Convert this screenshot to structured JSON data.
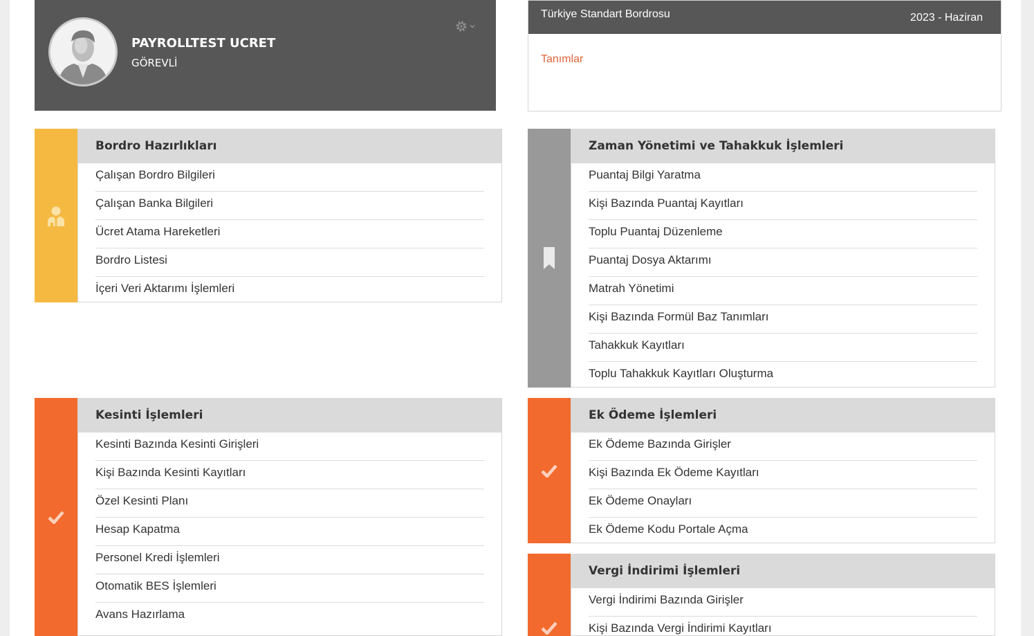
{
  "profile": {
    "name": "PAYROLLTEST UCRET",
    "role": "GÖREVLİ",
    "avatar_icon": "user-avatar",
    "settings_icon": "gear-icon"
  },
  "bordro": {
    "title": "Türkiye Standart Bordrosu",
    "period": "2023 - Haziran",
    "link": "Tanımlar"
  },
  "colors": {
    "header_bg": "#575757",
    "yellow": "#f5b942",
    "gray": "#999999",
    "orange": "#f26a2e",
    "panel_head_bg": "#dadada",
    "link": "#e0643c"
  },
  "panels": [
    {
      "title": "Bordro Hazırlıkları",
      "icon": "user-icon",
      "color": "#f5b942",
      "items": [
        "Çalışan Bordro Bilgileri",
        "Çalışan Banka Bilgileri",
        "Ücret Atama Hareketleri",
        "Bordro Listesi",
        "İçeri Veri Aktarımı İşlemleri"
      ]
    },
    {
      "title": "Zaman Yönetimi ve Tahakkuk İşlemleri",
      "icon": "bookmark-icon",
      "color": "#999999",
      "items": [
        "Puantaj Bilgi Yaratma",
        "Kişi Bazında Puantaj Kayıtları",
        "Toplu Puantaj Düzenleme",
        "Puantaj Dosya Aktarımı",
        "Matrah Yönetimi",
        "Kişi Bazında Formül Baz Tanımları",
        "Tahakkuk Kayıtları",
        "Toplu Tahakkuk Kayıtları Oluşturma"
      ]
    },
    {
      "title": "Kesinti İşlemleri",
      "icon": "check-icon",
      "color": "#f26a2e",
      "items": [
        "Kesinti Bazında Kesinti Girişleri",
        "Kişi Bazında Kesinti Kayıtları",
        "Özel Kesinti Planı",
        "Hesap Kapatma",
        "Personel Kredi İşlemleri",
        "Otomatik BES İşlemleri",
        "Avans Hazırlama"
      ]
    },
    {
      "title": "Ek Ödeme İşlemleri",
      "icon": "check-icon",
      "color": "#f26a2e",
      "items": [
        "Ek Ödeme Bazında Girişler",
        "Kişi Bazında Ek Ödeme Kayıtları",
        "Ek Ödeme Onayları",
        "Ek Ödeme Kodu Portale Açma"
      ]
    },
    {
      "title": "Vergi İndirimi İşlemleri",
      "icon": "check-icon",
      "color": "#f26a2e",
      "items": [
        "Vergi İndirimi Bazında Girişler",
        "Kişi Bazında Vergi İndirimi Kayıtları"
      ]
    }
  ]
}
